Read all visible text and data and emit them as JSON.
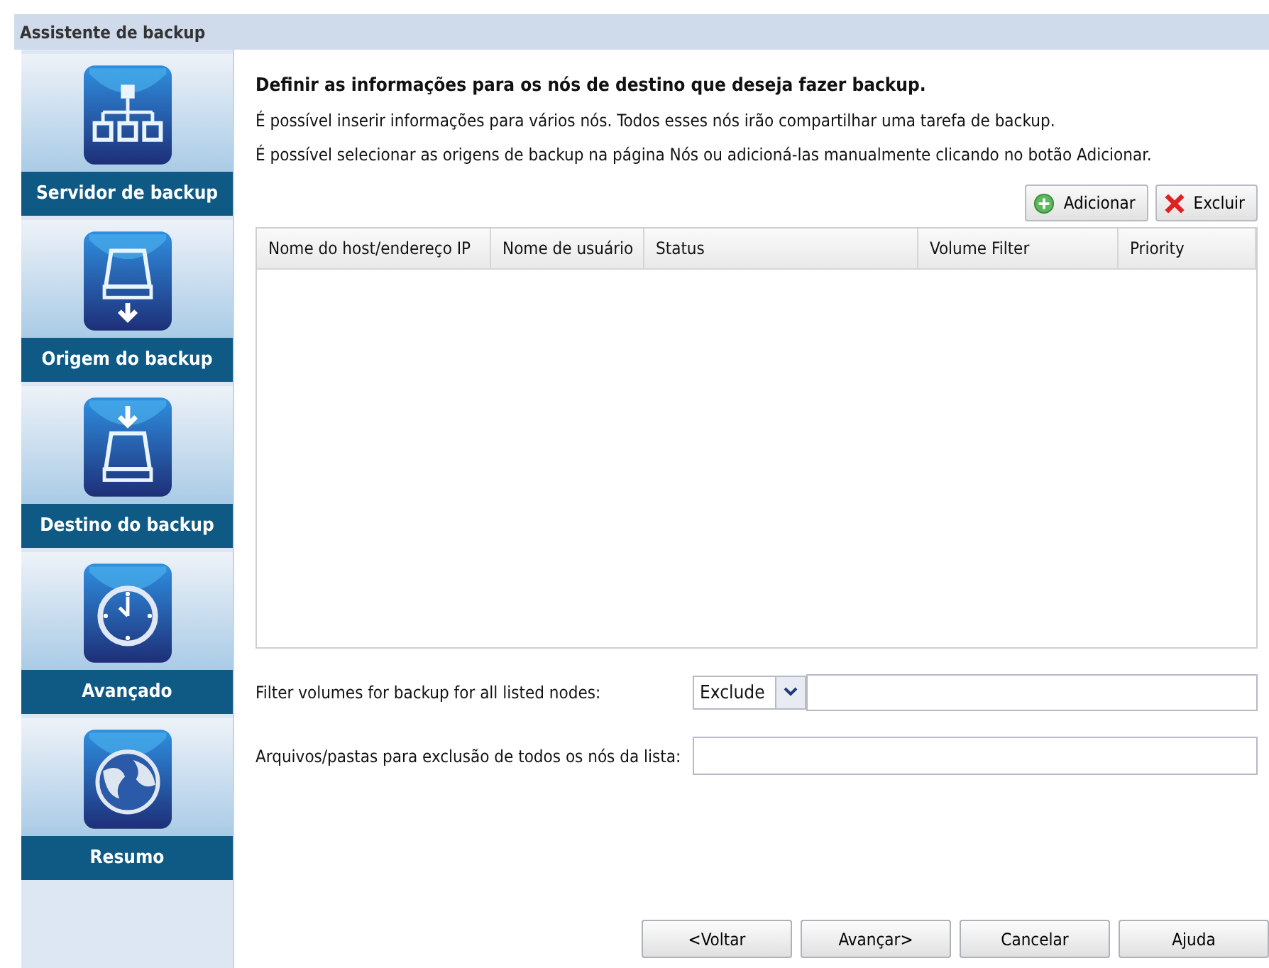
{
  "window": {
    "title": "Assistente de backup"
  },
  "steps": [
    {
      "label": "Servidor de backup",
      "kind": "network"
    },
    {
      "label": "Origem do backup",
      "kind": "drive-out"
    },
    {
      "label": "Destino do backup",
      "kind": "drive-in"
    },
    {
      "label": "Avançado",
      "kind": "clock"
    },
    {
      "label": "Resumo",
      "kind": "globe"
    }
  ],
  "heading": "Definir as informações para os nós de destino que deseja fazer backup.",
  "paragraphs": [
    "É possível inserir informações para vários nós. Todos esses nós irão compartilhar uma tarefa de backup.",
    "É possível selecionar as origens de backup na página Nós ou adicioná-las manualmente clicando no botão Adicionar."
  ],
  "toolbar": [
    {
      "label": "Adicionar",
      "kind": "add"
    },
    {
      "label": "Excluir",
      "kind": "delete"
    }
  ],
  "table": {
    "columns": [
      "Nome do host/endereço IP",
      "Nome de usuário",
      "Status",
      "Volume Filter",
      "Priority"
    ]
  },
  "filter": {
    "label": "Filter volumes for backup for all listed nodes:",
    "mode": "Exclude"
  },
  "exclusion": {
    "label": "Arquivos/pastas para exclusão de todos os nós da lista:"
  },
  "buttons": [
    "<Voltar",
    "Avançar>",
    "Cancelar",
    "Ajuda"
  ]
}
